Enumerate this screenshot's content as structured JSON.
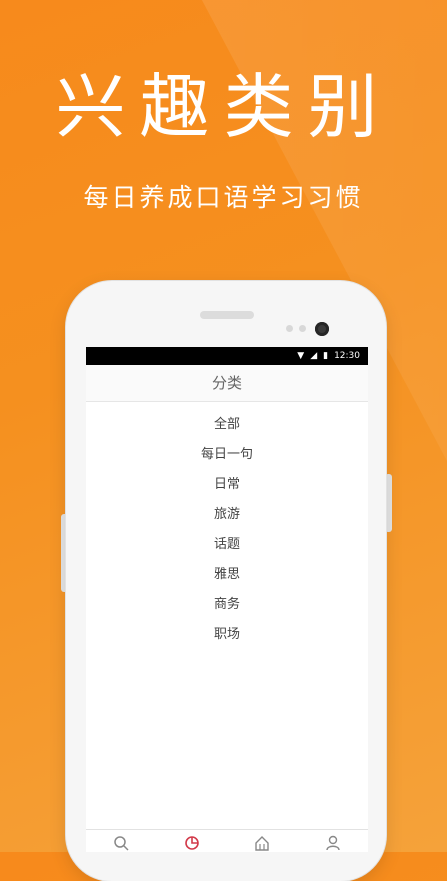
{
  "promo": {
    "headline": "兴趣类别",
    "subhead": "每日养成口语学习习惯"
  },
  "statusbar": {
    "time": "12:30",
    "wifi_icon": "wifi-icon",
    "signal_icon": "signal-icon",
    "battery_icon": "battery-icon"
  },
  "appbar": {
    "title": "分类"
  },
  "categories": [
    "全部",
    "每日一句",
    "日常",
    "旅游",
    "话题",
    "雅思",
    "商务",
    "职场"
  ],
  "bottom_nav": [
    {
      "icon": "search-icon"
    },
    {
      "icon": "category-icon",
      "active": true
    },
    {
      "icon": "home-icon"
    },
    {
      "icon": "profile-icon"
    }
  ],
  "colors": {
    "background": "#f78a1c",
    "accent": "#d23a4a"
  }
}
